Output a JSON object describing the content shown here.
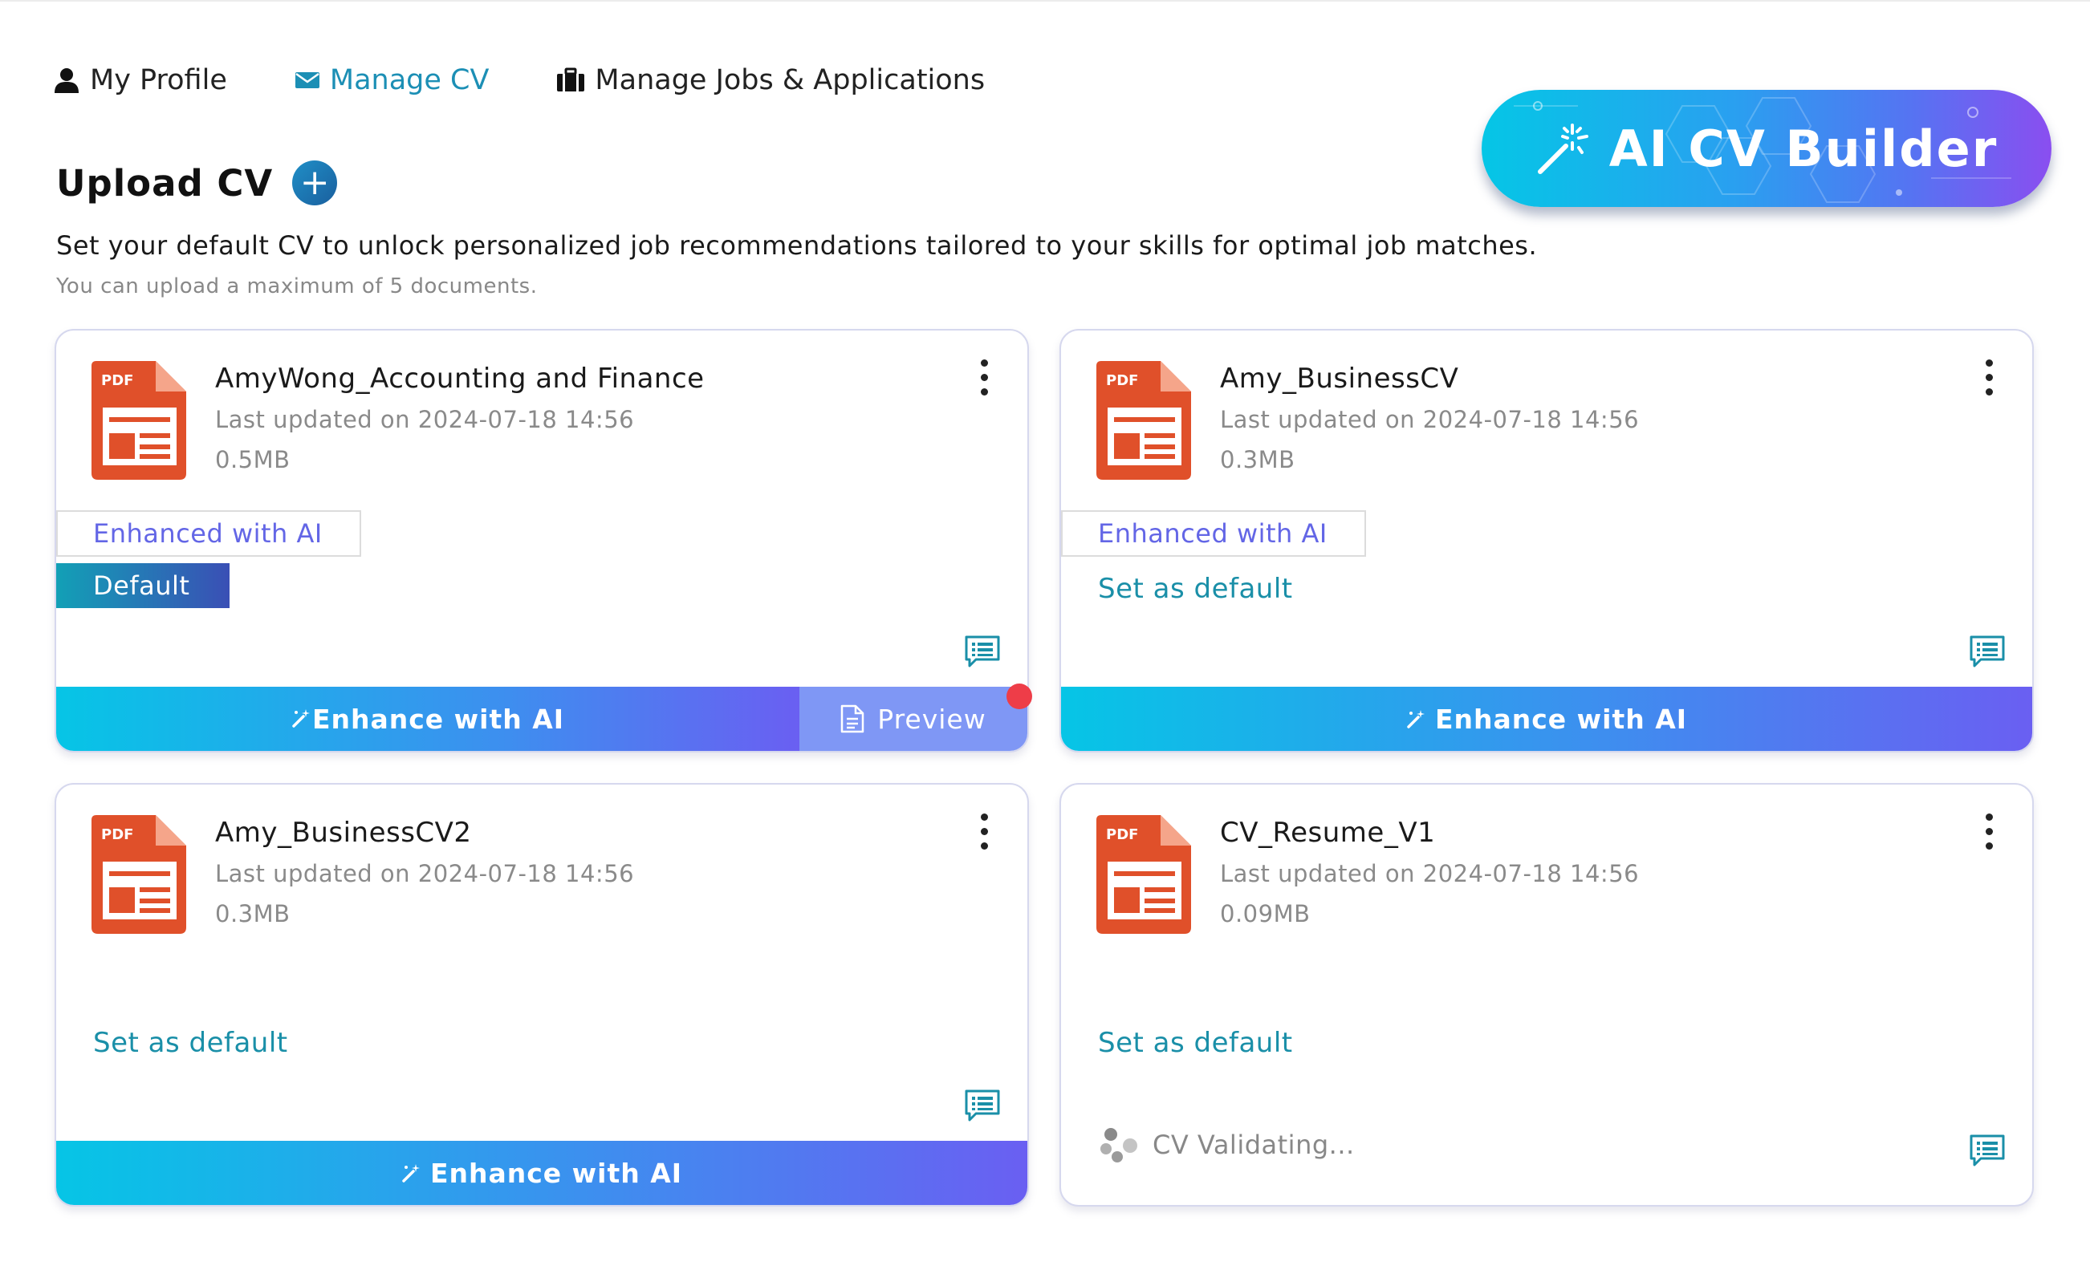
{
  "nav": {
    "tabs": [
      {
        "label": "My Profile",
        "icon": "user-icon",
        "active": false
      },
      {
        "label": "Manage CV",
        "icon": "envelope-icon",
        "active": true
      },
      {
        "label": "Manage Jobs & Applications",
        "icon": "briefcase-icon",
        "active": false
      }
    ]
  },
  "ai_builder": {
    "label": "AI CV Builder",
    "icon": "magic-wand-icon"
  },
  "upload": {
    "title": "Upload CV",
    "add_icon": "+",
    "description": "Set your default CV to unlock personalized job recommendations tailored to your skills for optimal job matches.",
    "hint": "You can upload a maximum of 5 documents."
  },
  "labels": {
    "pdf": "PDF",
    "enhanced": "Enhanced with AI",
    "default": "Default",
    "set_default": "Set as default",
    "enhance": "Enhance with AI",
    "preview": "Preview",
    "validating": "CV Validating..."
  },
  "cards": [
    {
      "name": "AmyWong_Accounting and Finance",
      "updated": "Last updated on 2024-07-18 14:56",
      "size": "0.5MB"
    },
    {
      "name": "Amy_BusinessCV",
      "updated": "Last updated on 2024-07-18 14:56",
      "size": "0.3MB"
    },
    {
      "name": "Amy_BusinessCV2",
      "updated": "Last updated on 2024-07-18 14:56",
      "size": "0.3MB"
    },
    {
      "name": "CV_Resume_V1",
      "updated": "Last updated on 2024-07-18 14:56",
      "size": "0.09MB"
    }
  ],
  "colors": {
    "accent_teal": "#1a8fa8",
    "accent_purple": "#6366e6",
    "pdf_red": "#e0502a",
    "notification": "#ee3d48"
  }
}
